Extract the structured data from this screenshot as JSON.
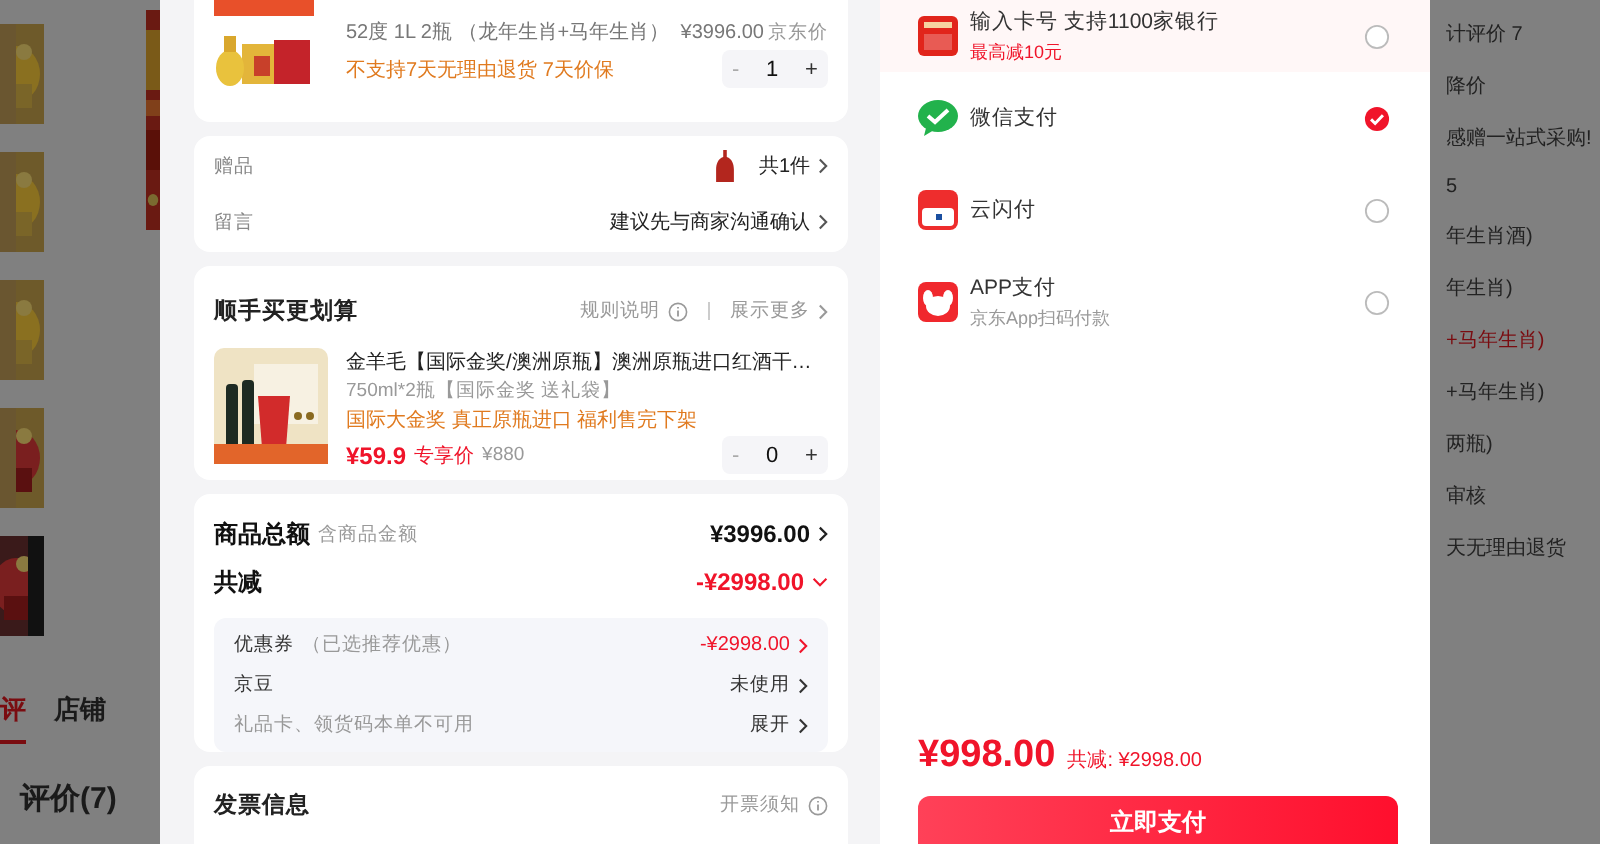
{
  "background_left": {
    "tabs": [
      {
        "label": "评",
        "selected": true
      },
      {
        "label": "店铺",
        "selected": false
      }
    ],
    "heading": "评价(7)"
  },
  "background_right": {
    "lines": [
      {
        "text": "计评价 7",
        "selected": false
      },
      {
        "text": "降价",
        "selected": false
      },
      {
        "text": "感赠一站式采购!",
        "selected": false
      },
      {
        "text": "5",
        "selected": false
      },
      {
        "text": "年生肖酒)",
        "selected": false
      },
      {
        "text": "年生肖)",
        "selected": false
      },
      {
        "text": "+马年生肖)",
        "selected": true
      },
      {
        "text": "+马年生肖)",
        "selected": false
      },
      {
        "text": "两瓶)",
        "selected": false
      },
      {
        "text": "审核",
        "selected": false
      },
      {
        "text": "天无理由退货",
        "selected": false
      }
    ]
  },
  "order": {
    "product": {
      "spec": "52度 1L 2瓶 （龙年生肖+马年生肖）",
      "price": "¥3996.00",
      "price_label": "京东价",
      "notes": "不支持7天无理由退货  7天价保",
      "quantity": "1",
      "minus": "-",
      "plus": "+"
    },
    "gift": {
      "label": "赠品",
      "value": "共1件"
    },
    "message": {
      "label": "留言",
      "value": "建议先与商家沟通确认"
    },
    "addon": {
      "title": "顺手买更划算",
      "rules": "规则说明",
      "more": "展示更多",
      "item": {
        "name": "金羊毛【国际金奖/澳洲原瓶】澳洲原瓶进口红酒干…",
        "spec": "750ml*2瓶【国际金奖 送礼袋】",
        "promo": "国际大金奖 真正原瓶进口 福利售完下架",
        "price": "¥59.9",
        "price_label": "专享价",
        "original_price": "¥880",
        "quantity": "0",
        "minus": "-",
        "plus": "+"
      }
    },
    "summary": {
      "total_label": "商品总额",
      "total_note": "含商品金额",
      "total": "¥3996.00",
      "discount_label": "共减",
      "discount": "-¥2998.00",
      "expanded": true,
      "rows": [
        {
          "label": "优惠券",
          "note": "（已选推荐优惠）",
          "value": "-¥2998.00",
          "kind": "discount"
        },
        {
          "label": "京豆",
          "value": "未使用",
          "kind": "plain"
        },
        {
          "label": "礼品卡、领货码本单不可用",
          "value": "展开",
          "kind": "muted"
        }
      ]
    },
    "invoice": {
      "title": "发票信息",
      "notice": "开票须知"
    }
  },
  "payment": {
    "methods": [
      {
        "kind": "card",
        "name": "输入卡号 支持1100家银行",
        "subtitle": "最高减10元",
        "highlighted": true,
        "selected": false
      },
      {
        "kind": "wechat",
        "name": "微信支付",
        "highlighted": false,
        "selected": true
      },
      {
        "kind": "unionpay",
        "name": "云闪付",
        "highlighted": false,
        "selected": false
      },
      {
        "kind": "app",
        "name": "APP支付",
        "subtitle": "京东App扫码付款",
        "highlighted": false,
        "selected": false
      }
    ],
    "total": "¥998.00",
    "saving": "共减: ¥2998.00",
    "pay_button": "立即支付"
  }
}
